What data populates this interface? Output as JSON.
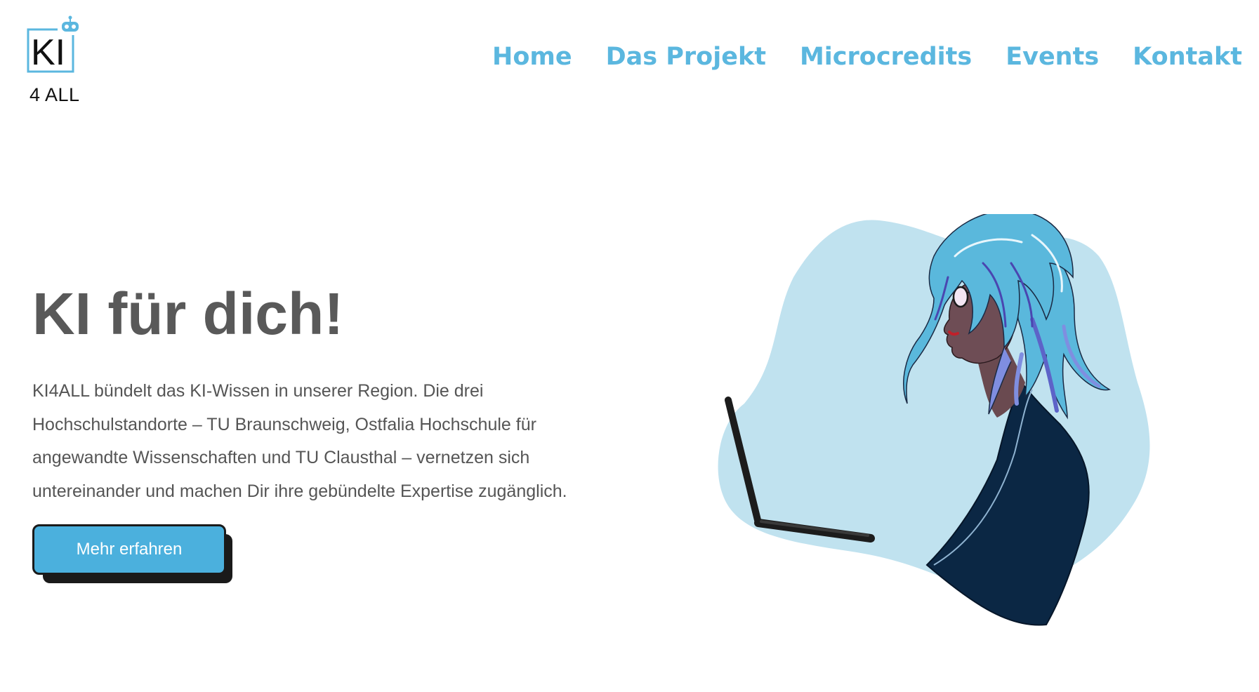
{
  "logo": {
    "mark_text": "KI",
    "caption": "4 ALL",
    "icon": "robot-head-icon",
    "accent_color": "#5bb7df"
  },
  "nav": {
    "items": [
      {
        "label": "Home"
      },
      {
        "label": "Das Projekt"
      },
      {
        "label": "Microcredits"
      },
      {
        "label": "Events"
      },
      {
        "label": "Kontakt"
      }
    ],
    "color": "#5bb7df"
  },
  "hero": {
    "title": "KI für dich!",
    "lines": [
      "KI4ALL bündelt das KI-Wissen in unserer Region. Die drei",
      "Hochschulstandorte – TU Braunschweig, Ostfalia Hochschule für",
      "angewandte Wissenschaften und TU Clausthal – vernetzen sich",
      "untereinander und machen Dir ihre gebündelte Expertise zugänglich."
    ],
    "cta_label": "Mehr erfahren",
    "cta_color": "#4bb0dd"
  },
  "illustration": {
    "subject": "woman-with-laptop-illustration",
    "blob_color": "#c0e2ef",
    "hair_color": "#5ab8dc",
    "shirt_color": "#0b2744"
  }
}
